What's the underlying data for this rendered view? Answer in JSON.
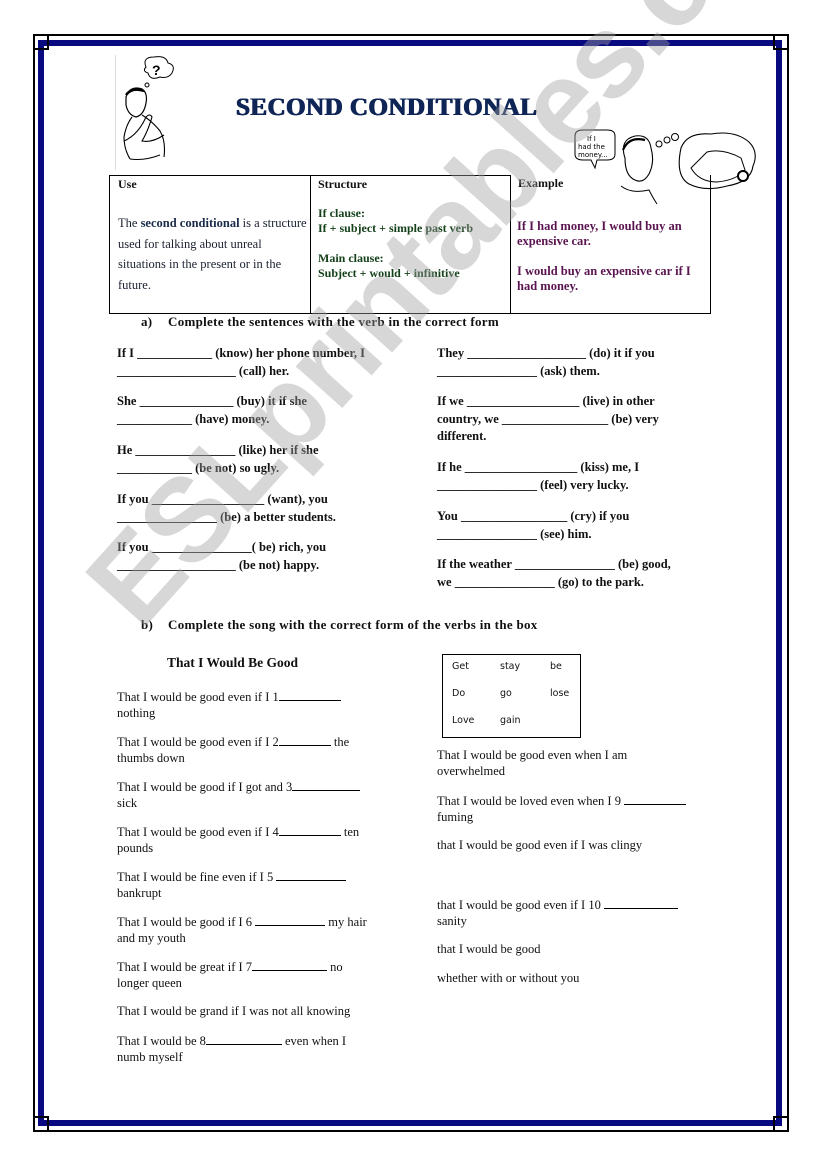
{
  "title": "SECOND CONDITIONAL",
  "clipart": {
    "thinker_icon": "question-mark",
    "car_bubble_text": "If I had the money..."
  },
  "table": {
    "headers": [
      "Use",
      "Structure",
      "Example"
    ],
    "use": {
      "pre": "The ",
      "bold": "second conditional",
      "post": " is a structure used for talking about unreal situations in the present or in the future."
    },
    "structure": {
      "if_label": "If clause:",
      "if_formula": "If + subject + simple past verb",
      "main_label": "Main clause:",
      "main_formula": "Subject + would +  infinitive"
    },
    "examples": [
      "If I had money, I would buy an expensive car.",
      "I would buy an expensive car if I had money."
    ]
  },
  "section_a": {
    "marker": "a)",
    "heading": "Complete the sentences with the verb in the correct form",
    "left": [
      {
        "l1": "If I ____________ (know) her phone number, I",
        "l2": "___________________ (call) her."
      },
      {
        "l1": "She _______________ (buy) it if she",
        "l2": "____________ (have) money."
      },
      {
        "l1": "He ________________ (like) her if she",
        "l2": "____________ (be not) so ugly."
      },
      {
        "l1": "If you __________________ (want),  you",
        "l2": "________________ (be) a better students."
      },
      {
        "l1": "If you ________________( be) rich, you",
        "l2": "___________________ (be not) happy."
      }
    ],
    "right": [
      {
        "l1": "They ___________________ (do) it if you",
        "l2": "________________ (ask) them."
      },
      {
        "l1": "If we __________________ (live) in other",
        "l2": "country, we _________________ (be) very",
        "l3": "different."
      },
      {
        "l1": "If he __________________ (kiss) me, I",
        "l2": "________________ (feel) very lucky.",
        "l3": ""
      },
      {
        "l1": "You _________________ (cry) if you",
        "l2": "________________ (see) him."
      },
      {
        "l1": "If the weather ________________ (be) good,",
        "l2": "we ________________ (go) to the park."
      }
    ]
  },
  "section_b": {
    "marker": "b)",
    "heading": "Complete the song with the correct form of the verbs in the box",
    "song_title": "That I Would Be Good",
    "word_box": [
      "Get",
      "stay",
      "be",
      "Do",
      "go",
      "lose",
      "Love",
      "gain"
    ],
    "left_lines": [
      {
        "pre": "That I would be good even if I 1",
        "post": "",
        "cont": "nothing"
      },
      {
        "pre": "That I would be good even if I 2",
        "post": " the",
        "cont": "thumbs down"
      },
      {
        "pre": "That I would be good if I got and 3",
        "post": "",
        "cont": "sick"
      },
      {
        "pre": "That I would be good even if I 4",
        "post": " ten",
        "cont": "pounds"
      },
      {
        "pre": "That I would be fine even if I 5 ",
        "post": "",
        "cont": "bankrupt"
      },
      {
        "pre": "That I would be good if I 6 ",
        "post": " my hair",
        "cont": "and my youth"
      },
      {
        "pre": "That I would be great if I 7",
        "post": " no",
        "cont": "longer queen"
      },
      {
        "pre": "That I would be grand if I was not all knowing",
        "post": "",
        "cont": "",
        "noblank": true
      },
      {
        "pre": "That I would be 8",
        "post": "  even when I",
        "cont": "numb myself"
      }
    ],
    "right_lines": [
      {
        "text": "That I would be good even when I am",
        "cont": "overwhelmed"
      },
      {
        "pre": "That I would be loved even when I 9 ",
        "cont": "fuming"
      },
      {
        "text": "that I would be good even if I was clingy",
        "cont": ""
      },
      {
        "pre": "that I would be good even if I 10 ",
        "cont": "sanity"
      },
      {
        "text": "that I would be good",
        "cont": ""
      },
      {
        "text": "whether with or without you",
        "cont": ""
      }
    ]
  },
  "watermark": "ESLprintables.com"
}
